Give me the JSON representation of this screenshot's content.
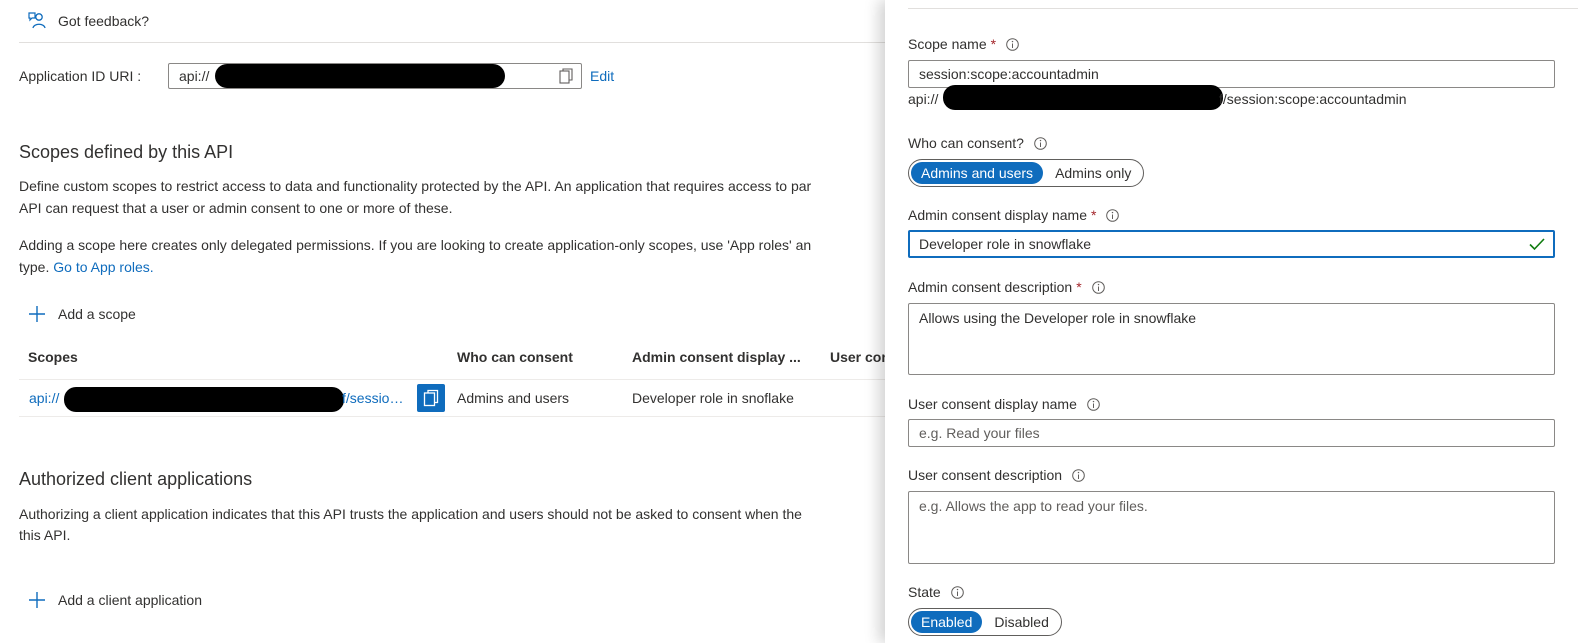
{
  "feedback": {
    "label": "Got feedback?"
  },
  "app_id": {
    "label": "Application ID URI :",
    "value_prefix": "api://",
    "edit_label": "Edit"
  },
  "scopes_section": {
    "title": "Scopes defined by this API",
    "desc_line1": "Define custom scopes to restrict access to data and functionality protected by the API. An application that requires access to par",
    "desc_line2": "API can request that a user or admin consent to one or more of these.",
    "desc_line3": "Adding a scope here creates only delegated permissions. If you are looking to create application-only scopes, use 'App roles' an",
    "desc_line4_prefix": "type.",
    "desc_line4_link": "Go to App roles.",
    "add_scope_label": "Add a scope",
    "columns": [
      "Scopes",
      "Who can consent",
      "Admin consent display ...",
      "User con"
    ],
    "rows": [
      {
        "scope_prefix": "api://",
        "scope_suffix": "f/sessio…",
        "who_can_consent": "Admins and users",
        "admin_display": "Developer role in snoflake"
      }
    ]
  },
  "authorized_section": {
    "title": "Authorized client applications",
    "desc_line1": "Authorizing a client application indicates that this API trusts the application and users should not be asked to consent when the",
    "desc_line2": "this API.",
    "add_client_label": "Add a client application"
  },
  "panel": {
    "scope_name": {
      "label": "Scope name",
      "required": "*",
      "value": "session:scope:accountadmin",
      "uri_prefix": "api://",
      "uri_suffix": "f/session:scope:accountadmin"
    },
    "who_can_consent": {
      "label": "Who can consent?",
      "options": [
        "Admins and users",
        "Admins only"
      ],
      "selected": "Admins and users"
    },
    "admin_display_name": {
      "label": "Admin consent display name",
      "required": "*",
      "value": "Developer role in snowflake"
    },
    "admin_description": {
      "label": "Admin consent description",
      "required": "*",
      "value": "Allows using the Developer role in snowflake"
    },
    "user_display_name": {
      "label": "User consent display name",
      "placeholder": "e.g. Read your files"
    },
    "user_description": {
      "label": "User consent description",
      "placeholder": "e.g. Allows the app to read your files."
    },
    "state": {
      "label": "State",
      "options": [
        "Enabled",
        "Disabled"
      ],
      "selected": "Enabled"
    }
  },
  "colors": {
    "accent": "#0f6cbd",
    "required": "#a4262c",
    "valid": "#107c10",
    "text": "#323130"
  },
  "icons": [
    "feedback-icon",
    "copy-icon",
    "edit-link",
    "add-icon",
    "info-icon",
    "check-icon"
  ]
}
